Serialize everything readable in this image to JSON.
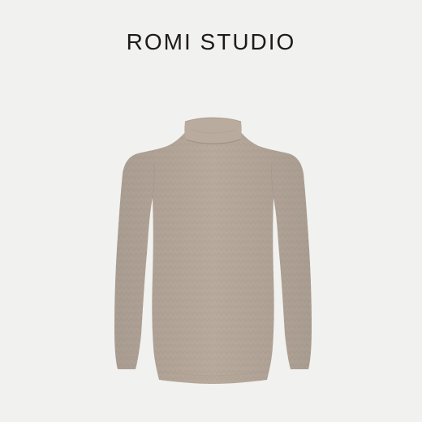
{
  "brand": {
    "name": "ROMI STUDIO"
  },
  "product": {
    "image_icon": "turtleneck-sweater-icon",
    "color": "#b6a89b"
  },
  "colors": {
    "background": "#f1f1ef",
    "brand_text": "#1e1a18"
  }
}
